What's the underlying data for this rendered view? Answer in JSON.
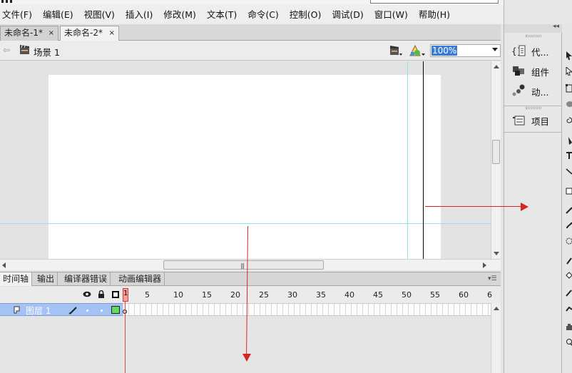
{
  "menubar": {
    "items": [
      "文件(F)",
      "编辑(E)",
      "视图(V)",
      "插入(I)",
      "修改(M)",
      "文本(T)",
      "命令(C)",
      "控制(O)",
      "调试(D)",
      "窗口(W)",
      "帮助(H)"
    ]
  },
  "documents": {
    "tabs": [
      {
        "label": "未命名-1*",
        "close": "×",
        "active": false
      },
      {
        "label": "未命名-2*",
        "close": "×",
        "active": true
      }
    ]
  },
  "scene_bar": {
    "scene_label": "场景 1",
    "zoom": "100%"
  },
  "panel_tabs": [
    "时间轴",
    "输出",
    "编译器错误",
    "动画编辑器"
  ],
  "timeline": {
    "current_frame": "1",
    "ruler": [
      "5",
      "10",
      "15",
      "20",
      "25",
      "30",
      "35",
      "40",
      "45",
      "50",
      "55",
      "60",
      "6"
    ],
    "layer": {
      "name": "图层 1",
      "color": "#5dde5d"
    }
  },
  "right_dock": {
    "items": [
      {
        "label": "代...",
        "icon": "code-snippets-icon"
      },
      {
        "label": "组件",
        "icon": "components-icon"
      },
      {
        "label": "动...",
        "icon": "motion-presets-icon"
      }
    ],
    "library_label": "项目"
  },
  "hscroll": {
    "grip": "|||"
  },
  "colors": {
    "guide": "#8fe3ea",
    "selection": "#3a7bd5",
    "layer_selected": "#a4c2f4",
    "annotation": "#d32626"
  }
}
